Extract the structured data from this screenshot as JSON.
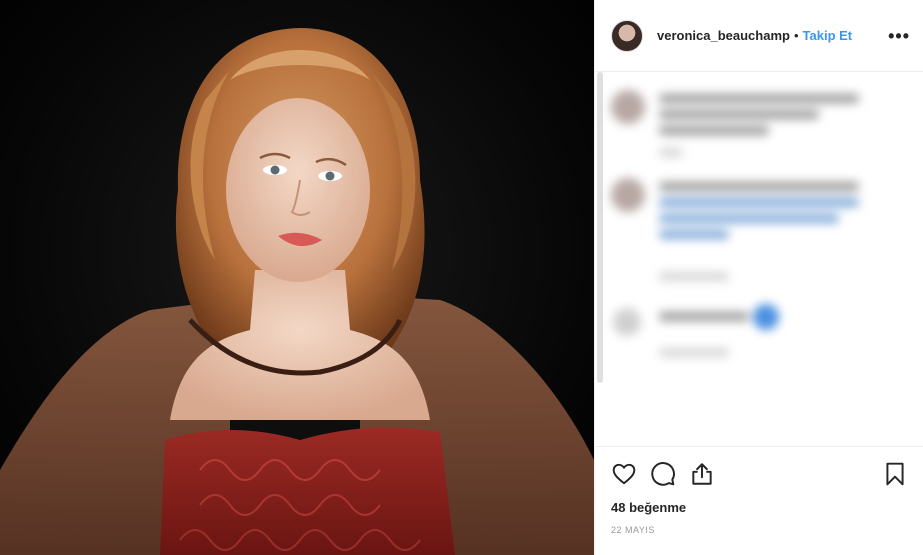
{
  "header": {
    "username": "veronica_beauchamp",
    "separator": "•",
    "follow_label": "Takip Et",
    "more_label": "•••"
  },
  "actions": {
    "like_icon": "heart-outline-icon",
    "comment_icon": "speech-bubble-icon",
    "share_icon": "share-upload-icon",
    "save_icon": "bookmark-outline-icon"
  },
  "likes": {
    "text": "48 beğenme"
  },
  "date": {
    "text": "22 MAYIS"
  },
  "colors": {
    "accent": "#3897f0",
    "text": "#262626",
    "muted": "#999999"
  }
}
